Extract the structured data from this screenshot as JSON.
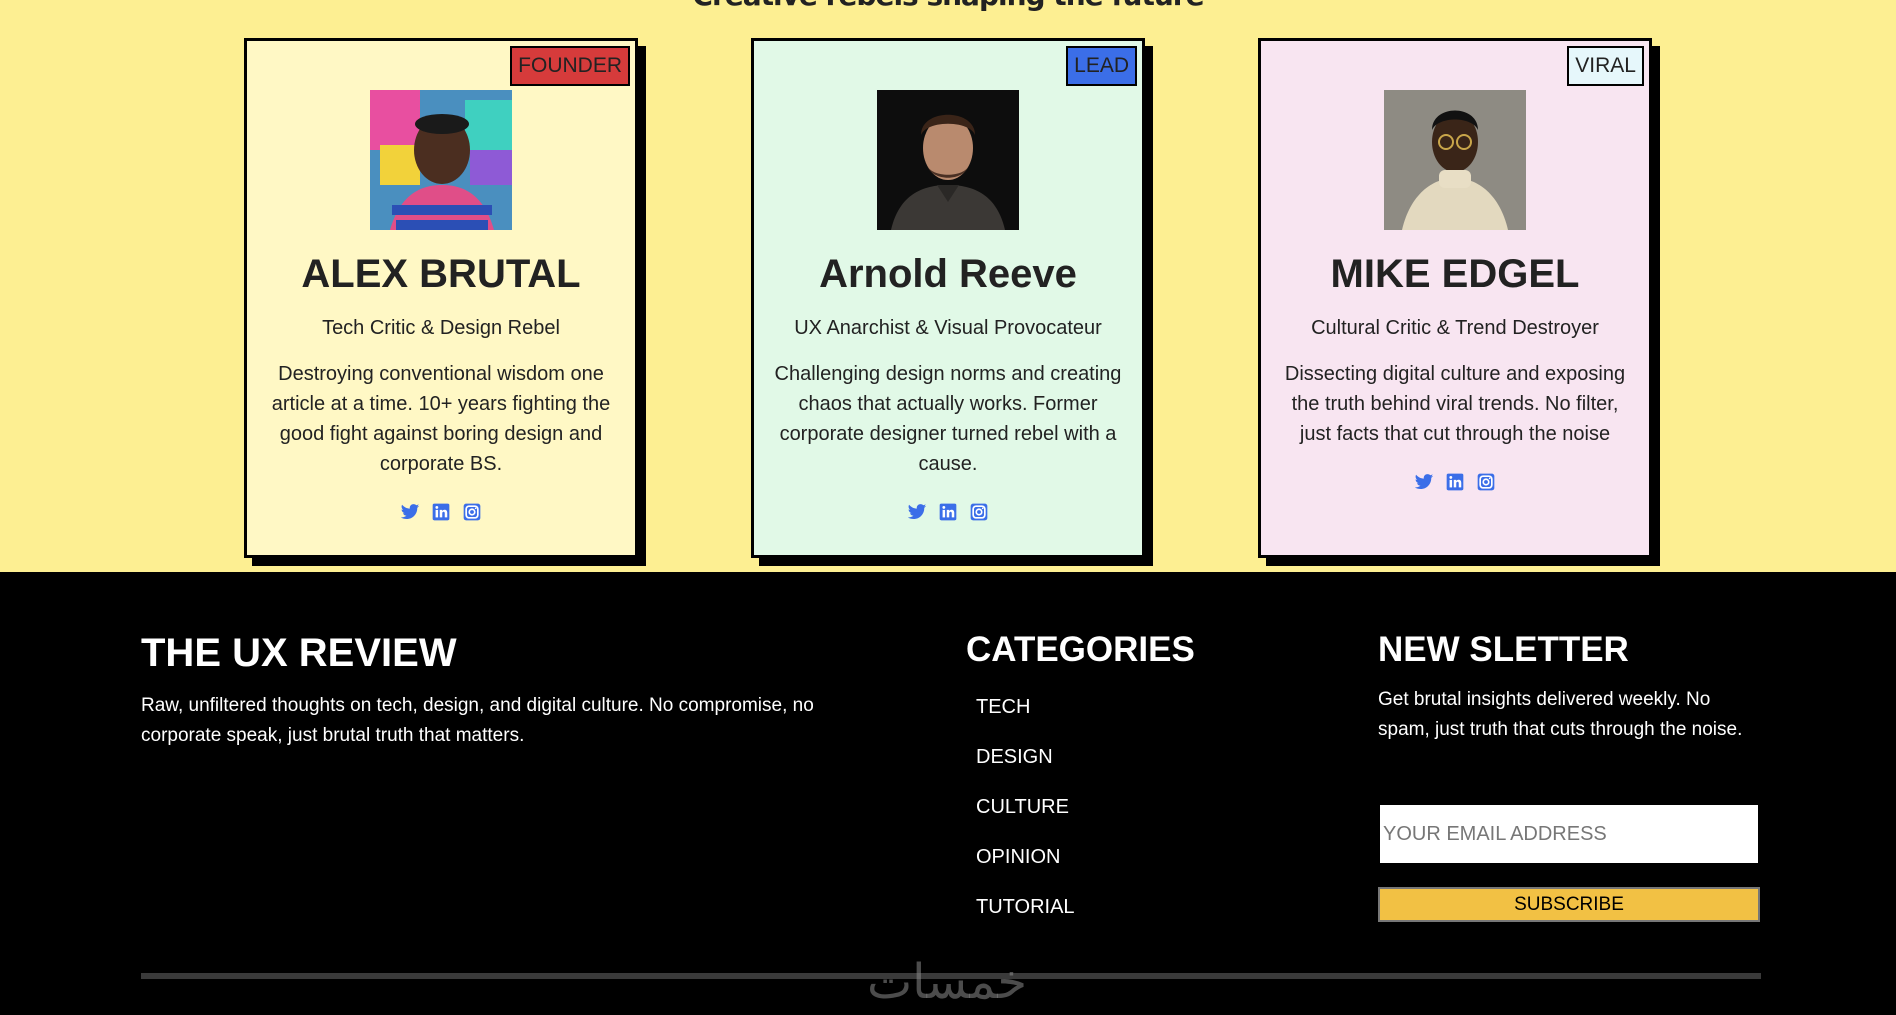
{
  "team": {
    "heading": "Creative rebels shaping the future",
    "members": [
      {
        "badge": "FOUNDER",
        "badge_color": "#d63b3b",
        "name": "ALEX BRUTAL",
        "role": "Tech Critic & Design Rebel",
        "bio": "Destroying conventional wisdom one article at a time. 10+ years fighting the good fight against boring design and corporate BS.",
        "card_color": "#fff8c5",
        "socials": [
          "twitter-icon",
          "linkedin-icon",
          "instagram-icon"
        ]
      },
      {
        "badge": "LEAD",
        "badge_color": "#3b6ee8",
        "name": "Arnold Reeve",
        "role": "UX Anarchist & Visual Provocateur",
        "bio": "Challenging design norms and creating chaos that actually works. Former corporate designer turned rebel with a cause.",
        "card_color": "#e1f9e7",
        "socials": [
          "twitter-icon",
          "linkedin-icon",
          "instagram-icon"
        ]
      },
      {
        "badge": "VIRAL",
        "badge_color": "#e6f7fb",
        "name": "MIKE EDGEL",
        "role": "Cultural Critic & Trend Destroyer",
        "bio": "Dissecting digital culture and exposing the truth behind viral trends. No filter, just facts that cut through the noise",
        "card_color": "#f8e5f1",
        "socials": [
          "twitter-icon",
          "linkedin-icon",
          "instagram-icon"
        ]
      }
    ]
  },
  "footer": {
    "brand_title": "THE UX REVIEW",
    "brand_desc": "Raw, unfiltered thoughts on tech, design, and digital culture. No compromise, no corporate speak, just brutal truth that matters.",
    "categories_title": "CATEGORIES",
    "categories": [
      "TECH",
      "DESIGN",
      "CULTURE",
      "OPINION",
      "TUTORIAL"
    ],
    "newsletter_title": "NEW SLETTER",
    "newsletter_desc": "Get brutal insights delivered weekly. No spam, just truth that cuts through the noise.",
    "email_placeholder": "YOUR EMAIL ADDRESS",
    "subscribe_label": "SUBSCRIBE",
    "watermark": "خمسات"
  },
  "colors": {
    "page_bg": "#fdef92",
    "footer_bg": "#000000",
    "accent_blue": "#3b6ee8",
    "subscribe_bg": "#f2c144"
  }
}
